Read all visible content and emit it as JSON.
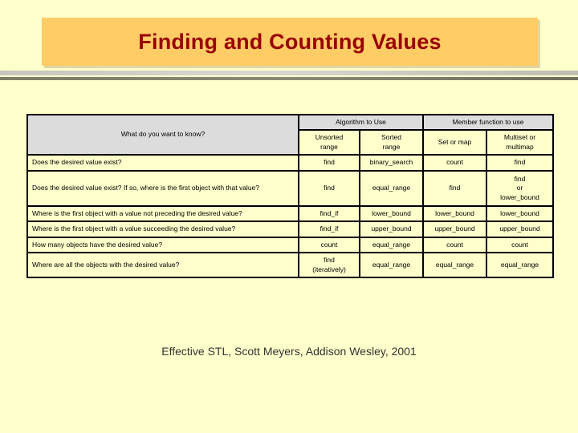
{
  "slide": {
    "title": "Finding and Counting Values",
    "background_color": "#FFFFCC",
    "banner_color": "#FFCC66",
    "title_color": "#990000",
    "footer": "Effective STL, Scott Meyers, Addison Wesley, 2001"
  },
  "table": {
    "group_headers": {
      "question": "What do you want to know?",
      "algorithm": "Algorithm to Use",
      "member_function": "Member function to use"
    },
    "sub_headers": [
      "Unsorted\nrange",
      "Sorted\nrange",
      "Set or map",
      "Multiset or\nmultimap"
    ],
    "sub_headers_flat": {
      "unsorted_range": "Unsorted range",
      "sorted_range": "Sorted range",
      "set_or_map": "Set or map",
      "multiset_or_multimap": "Multiset or multimap"
    },
    "rows": [
      {
        "question": "Does the desired value exist?",
        "unsorted_range": "find",
        "sorted_range": "binary_search",
        "set_or_map": "count",
        "multiset_or_multimap": "find"
      },
      {
        "question": "Does the desired value exist?  If so, where is the first object with that value?",
        "unsorted_range": "find",
        "sorted_range": "equal_range",
        "set_or_map": "find",
        "multiset_or_multimap": "find\nor\nlower_bound"
      },
      {
        "question": "Where is the first object with a value not preceding the desired value?",
        "unsorted_range": "find_if",
        "sorted_range": "lower_bound",
        "set_or_map": "lower_bound",
        "multiset_or_multimap": "lower_bound"
      },
      {
        "question": "Where is the first object with a value succeeding the desired value?",
        "unsorted_range": "find_if",
        "sorted_range": "upper_bound",
        "set_or_map": "upper_bound",
        "multiset_or_multimap": "upper_bound"
      },
      {
        "question": "How many objects have the desired value?",
        "unsorted_range": "count",
        "sorted_range": "equal_range",
        "set_or_map": "count",
        "multiset_or_multimap": "count"
      },
      {
        "question": "Where are all the objects with the desired value?",
        "unsorted_range": "find\n(iteratively)",
        "sorted_range": "equal_range",
        "set_or_map": "equal_range",
        "multiset_or_multimap": "equal_range"
      }
    ]
  }
}
